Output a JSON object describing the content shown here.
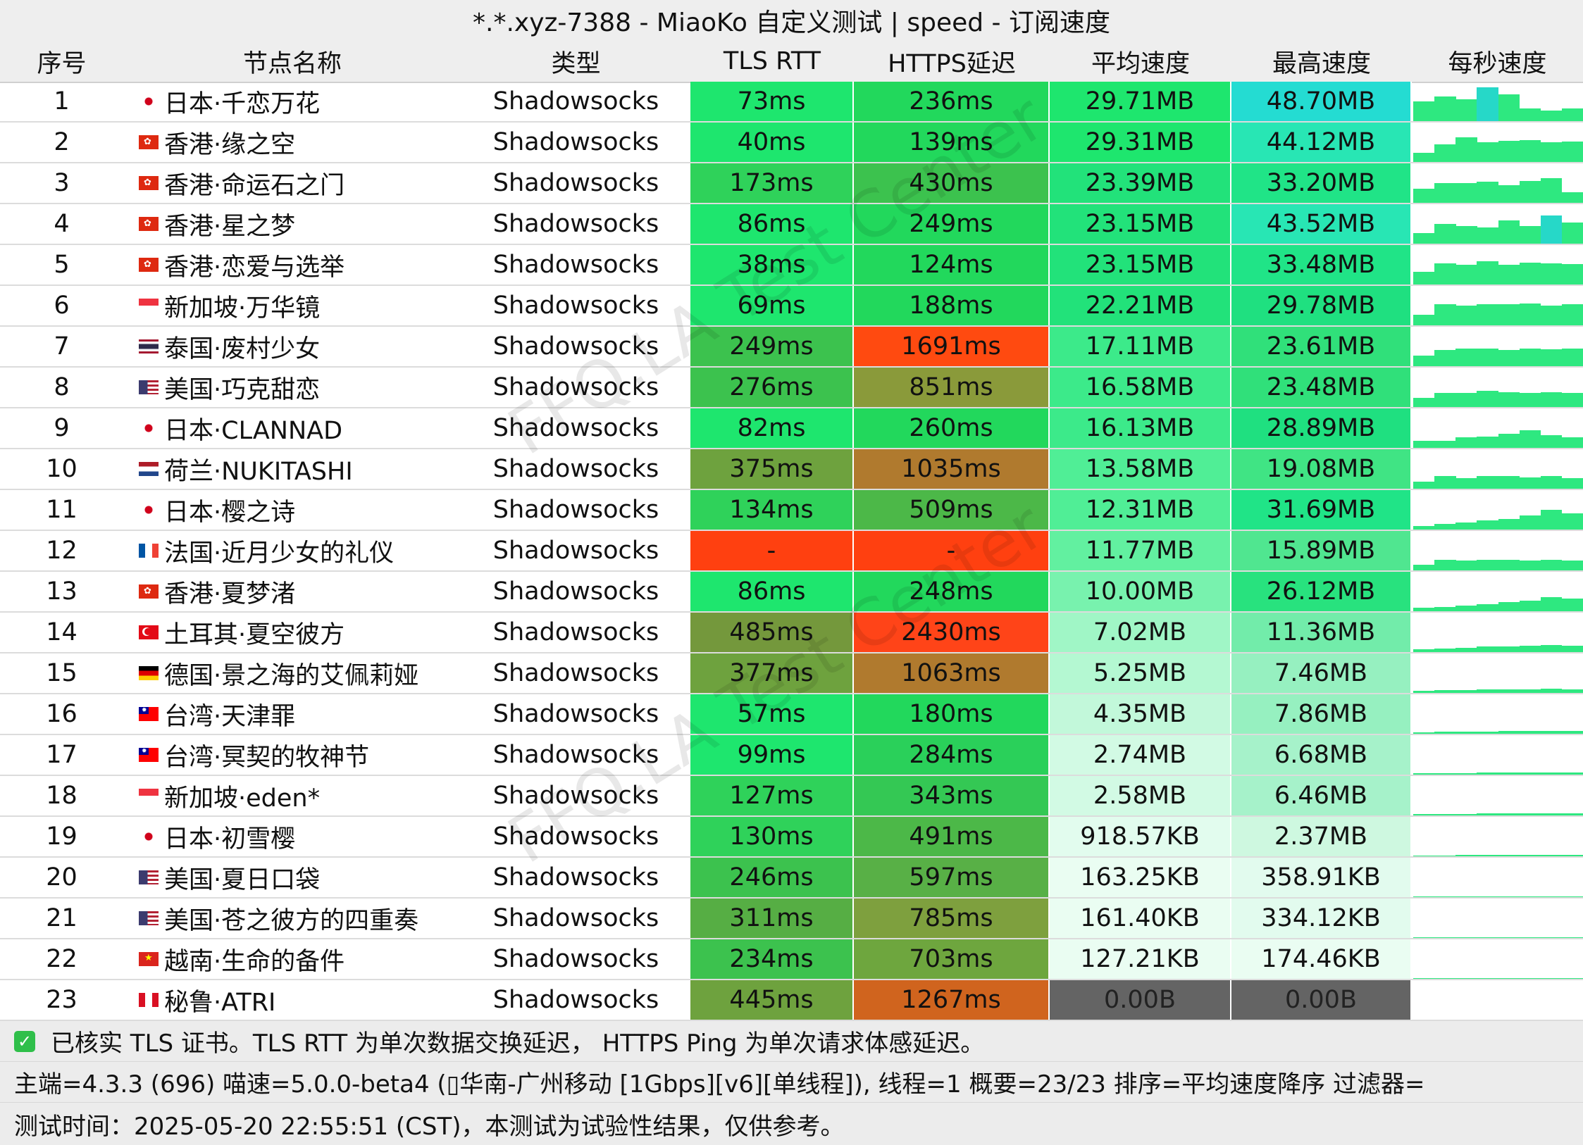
{
  "title": "*.*.xyz-7388 - MiaoKo 自定义测试 | speed - 订阅速度",
  "headers": [
    "序号",
    "节点名称",
    "类型",
    "TLS RTT",
    "HTTPS延迟",
    "平均速度",
    "最高速度",
    "每秒速度"
  ],
  "rows": [
    {
      "idx": "1",
      "flag": "jp-flag-icon",
      "name": "日本·千恋万花",
      "type": "Shadowsocks",
      "tls": "73ms",
      "tls_color": "#1ee66e",
      "https": "236ms",
      "https_color": "#22d85c",
      "avg": "29.71MB",
      "avg_color": "#1ee66e",
      "max": "48.70MB",
      "max_color": "#24dcd2",
      "spark": [
        0.55,
        0.7,
        0.62,
        0.95,
        0.75,
        0.35,
        0.3,
        0.35
      ]
    },
    {
      "idx": "2",
      "flag": "hk-flag-icon",
      "name": "香港·缘之空",
      "type": "Shadowsocks",
      "tls": "40ms",
      "tls_color": "#1ee66e",
      "https": "139ms",
      "https_color": "#22d85c",
      "avg": "29.31MB",
      "avg_color": "#1ee66e",
      "max": "44.12MB",
      "max_color": "#28e6b4",
      "spark": [
        0.25,
        0.5,
        0.7,
        0.55,
        0.6,
        0.62,
        0.55,
        0.58
      ]
    },
    {
      "idx": "3",
      "flag": "hk-flag-icon",
      "name": "香港·命运石之门",
      "type": "Shadowsocks",
      "tls": "173ms",
      "tls_color": "#2fd25a",
      "https": "430ms",
      "https_color": "#3cc24e",
      "avg": "23.39MB",
      "avg_color": "#22e27a",
      "max": "33.20MB",
      "max_color": "#20e487",
      "spark": [
        0.4,
        0.55,
        0.55,
        0.6,
        0.5,
        0.62,
        0.7,
        0.3
      ]
    },
    {
      "idx": "4",
      "flag": "hk-flag-icon",
      "name": "香港·星之梦",
      "type": "Shadowsocks",
      "tls": "86ms",
      "tls_color": "#1ee66e",
      "https": "249ms",
      "https_color": "#22d85c",
      "avg": "23.15MB",
      "avg_color": "#22e27a",
      "max": "43.52MB",
      "max_color": "#28e6b4",
      "spark": [
        0.3,
        0.55,
        0.5,
        0.45,
        0.65,
        0.5,
        0.8,
        0.6
      ]
    },
    {
      "idx": "5",
      "flag": "hk-flag-icon",
      "name": "香港·恋爱与选举",
      "type": "Shadowsocks",
      "tls": "38ms",
      "tls_color": "#1ee66e",
      "https": "124ms",
      "https_color": "#22d85c",
      "avg": "23.15MB",
      "avg_color": "#22e27a",
      "max": "33.48MB",
      "max_color": "#20e487",
      "spark": [
        0.35,
        0.6,
        0.55,
        0.65,
        0.55,
        0.62,
        0.6,
        0.58
      ]
    },
    {
      "idx": "6",
      "flag": "sg-flag-icon",
      "name": "新加坡·万华镜",
      "type": "Shadowsocks",
      "tls": "69ms",
      "tls_color": "#1ee66e",
      "https": "188ms",
      "https_color": "#22d85c",
      "avg": "22.21MB",
      "avg_color": "#22e27a",
      "max": "29.78MB",
      "max_color": "#1fe080",
      "spark": [
        0.3,
        0.6,
        0.55,
        0.6,
        0.6,
        0.62,
        0.55,
        0.6
      ]
    },
    {
      "idx": "7",
      "flag": "th-flag-icon",
      "name": "泰国·废村少女",
      "type": "Shadowsocks",
      "tls": "249ms",
      "tls_color": "#3cc24e",
      "https": "1691ms",
      "https_color": "#ff4a10",
      "avg": "17.11MB",
      "avg_color": "#3cea8a",
      "max": "23.61MB",
      "max_color": "#30e07a",
      "spark": [
        0.3,
        0.45,
        0.5,
        0.5,
        0.45,
        0.5,
        0.48,
        0.5
      ]
    },
    {
      "idx": "8",
      "flag": "us-flag-icon",
      "name": "美国·巧克甜恋",
      "type": "Shadowsocks",
      "tls": "276ms",
      "tls_color": "#3cc24e",
      "https": "851ms",
      "https_color": "#8a9a3a",
      "avg": "16.58MB",
      "avg_color": "#3cea8a",
      "max": "23.48MB",
      "max_color": "#30e07a",
      "spark": [
        0.25,
        0.4,
        0.4,
        0.45,
        0.42,
        0.4,
        0.42,
        0.4
      ]
    },
    {
      "idx": "9",
      "flag": "jp-flag-icon",
      "name": "日本·CLANNAD",
      "type": "Shadowsocks",
      "tls": "82ms",
      "tls_color": "#1ee66e",
      "https": "260ms",
      "https_color": "#22d85c",
      "avg": "16.13MB",
      "avg_color": "#3cea8a",
      "max": "28.89MB",
      "max_color": "#1fe080",
      "spark": [
        0.2,
        0.2,
        0.3,
        0.32,
        0.4,
        0.5,
        0.35,
        0.3
      ]
    },
    {
      "idx": "10",
      "flag": "nl-flag-icon",
      "name": "荷兰·NUKITASHI",
      "type": "Shadowsocks",
      "tls": "375ms",
      "tls_color": "#6ea23e",
      "https": "1035ms",
      "https_color": "#b07a2e",
      "avg": "13.58MB",
      "avg_color": "#50ee96",
      "max": "19.08MB",
      "max_color": "#40e484",
      "spark": [
        0.2,
        0.35,
        0.3,
        0.35,
        0.35,
        0.32,
        0.35,
        0.3
      ]
    },
    {
      "idx": "11",
      "flag": "jp-flag-icon",
      "name": "日本·樱之诗",
      "type": "Shadowsocks",
      "tls": "134ms",
      "tls_color": "#2fd25a",
      "https": "509ms",
      "https_color": "#4cb848",
      "avg": "12.31MB",
      "avg_color": "#50ee96",
      "max": "31.69MB",
      "max_color": "#20e487",
      "spark": [
        0.1,
        0.15,
        0.2,
        0.25,
        0.3,
        0.4,
        0.55,
        0.45
      ]
    },
    {
      "idx": "12",
      "flag": "fr-flag-icon",
      "name": "法国·近月少女的礼仪",
      "type": "Shadowsocks",
      "tls": "-",
      "tls_color": "#ff4010",
      "https": "-",
      "https_color": "#ff4010",
      "avg": "11.77MB",
      "avg_color": "#62f0a0",
      "max": "15.89MB",
      "max_color": "#50e690",
      "spark": [
        0.15,
        0.3,
        0.28,
        0.3,
        0.3,
        0.28,
        0.3,
        0.28
      ]
    },
    {
      "idx": "13",
      "flag": "hk-flag-icon",
      "name": "香港·夏梦渚",
      "type": "Shadowsocks",
      "tls": "86ms",
      "tls_color": "#1ee66e",
      "https": "248ms",
      "https_color": "#22d85c",
      "avg": "10.00MB",
      "avg_color": "#78f2ae",
      "max": "26.12MB",
      "max_color": "#28e27e",
      "spark": [
        0.1,
        0.12,
        0.15,
        0.2,
        0.25,
        0.3,
        0.4,
        0.35
      ]
    },
    {
      "idx": "14",
      "flag": "tr-flag-icon",
      "name": "土耳其·夏空彼方",
      "type": "Shadowsocks",
      "tls": "485ms",
      "tls_color": "#74983c",
      "https": "2430ms",
      "https_color": "#ff4418",
      "avg": "7.02MB",
      "avg_color": "#a0f6c6",
      "max": "11.36MB",
      "max_color": "#72ecaa",
      "spark": [
        0.08,
        0.1,
        0.12,
        0.15,
        0.15,
        0.18,
        0.2,
        0.18
      ]
    },
    {
      "idx": "15",
      "flag": "de-flag-icon",
      "name": "德国·景之海的艾佩莉娅",
      "type": "Shadowsocks",
      "tls": "377ms",
      "tls_color": "#6ea23e",
      "https": "1063ms",
      "https_color": "#b07a2e",
      "avg": "5.25MB",
      "avg_color": "#b4f8d2",
      "max": "7.46MB",
      "max_color": "#96f0c0",
      "spark": [
        0.05,
        0.08,
        0.08,
        0.1,
        0.1,
        0.1,
        0.12,
        0.1
      ]
    },
    {
      "idx": "16",
      "flag": "tw-flag-icon",
      "name": "台湾·天津罪",
      "type": "Shadowsocks",
      "tls": "57ms",
      "tls_color": "#1ee66e",
      "https": "180ms",
      "https_color": "#22d85c",
      "avg": "4.35MB",
      "avg_color": "#c2f8da",
      "max": "7.86MB",
      "max_color": "#96f0c0",
      "spark": [
        0.04,
        0.05,
        0.06,
        0.06,
        0.07,
        0.08,
        0.08,
        0.08
      ]
    },
    {
      "idx": "17",
      "flag": "tw-flag-icon",
      "name": "台湾·冥契的牧神节",
      "type": "Shadowsocks",
      "tls": "99ms",
      "tls_color": "#1ee66e",
      "https": "284ms",
      "https_color": "#2ad05a",
      "avg": "2.74MB",
      "avg_color": "#d2fae4",
      "max": "6.68MB",
      "max_color": "#a6f2ca",
      "spark": [
        0.03,
        0.04,
        0.04,
        0.05,
        0.05,
        0.05,
        0.06,
        0.05
      ]
    },
    {
      "idx": "18",
      "flag": "sg-flag-icon",
      "name": "新加坡·eden*",
      "type": "Shadowsocks",
      "tls": "127ms",
      "tls_color": "#2fd25a",
      "https": "343ms",
      "https_color": "#34c854",
      "avg": "2.58MB",
      "avg_color": "#d2fae4",
      "max": "6.46MB",
      "max_color": "#a6f2ca",
      "spark": [
        0.03,
        0.04,
        0.04,
        0.05,
        0.05,
        0.05,
        0.05,
        0.05
      ]
    },
    {
      "idx": "19",
      "flag": "jp-flag-icon",
      "name": "日本·初雪樱",
      "type": "Shadowsocks",
      "tls": "130ms",
      "tls_color": "#2fd25a",
      "https": "491ms",
      "https_color": "#4cb848",
      "avg": "918.57KB",
      "avg_color": "#e2fcee",
      "max": "2.37MB",
      "max_color": "#cef8e0",
      "spark": [
        0.02,
        0.02,
        0.03,
        0.03,
        0.03,
        0.03,
        0.03,
        0.03
      ]
    },
    {
      "idx": "20",
      "flag": "us-flag-icon",
      "name": "美国·夏日口袋",
      "type": "Shadowsocks",
      "tls": "246ms",
      "tls_color": "#3cc24e",
      "https": "597ms",
      "https_color": "#58b046",
      "avg": "163.25KB",
      "avg_color": "#eafdf2",
      "max": "358.91KB",
      "max_color": "#e2fbee",
      "spark": [
        0.01,
        0.01,
        0.01,
        0.01,
        0.01,
        0.01,
        0.01,
        0.01
      ]
    },
    {
      "idx": "21",
      "flag": "us-flag-icon",
      "name": "美国·苍之彼方的四重奏",
      "type": "Shadowsocks",
      "tls": "311ms",
      "tls_color": "#56ae44",
      "https": "785ms",
      "https_color": "#7ea03e",
      "avg": "161.40KB",
      "avg_color": "#eafdf2",
      "max": "334.12KB",
      "max_color": "#e2fbee",
      "spark": [
        0.01,
        0.01,
        0.01,
        0.01,
        0.01,
        0.01,
        0.01,
        0.01
      ]
    },
    {
      "idx": "22",
      "flag": "vn-flag-icon",
      "name": "越南·生命的备件",
      "type": "Shadowsocks",
      "tls": "234ms",
      "tls_color": "#3cc24e",
      "https": "703ms",
      "https_color": "#6ea63e",
      "avg": "127.21KB",
      "avg_color": "#eafdf2",
      "max": "174.46KB",
      "max_color": "#eafdf2",
      "spark": [
        0.01,
        0.01,
        0.01,
        0.01,
        0.01,
        0.01,
        0.01,
        0.01
      ]
    },
    {
      "idx": "23",
      "flag": "pe-flag-icon",
      "name": "秘鲁·ATRI",
      "type": "Shadowsocks",
      "tls": "445ms",
      "tls_color": "#6ea23e",
      "https": "1267ms",
      "https_color": "#d0641e",
      "avg": "0.00B",
      "avg_color": "#646464",
      "max": "0.00B",
      "max_color": "#646464",
      "spark": [
        0,
        0,
        0,
        0,
        0,
        0,
        0,
        0
      ]
    }
  ],
  "footer": {
    "line1": "已核实 TLS 证书。TLS RTT 为单次数据交换延迟， HTTPS Ping 为单次请求体感延迟。",
    "line2": "主端=4.3.3 (696) 喵速=5.0.0-beta4 (▯华南-广州移动 [1Gbps][v6][单线程]), 线程=1 概要=23/23 排序=平均速度降序 过滤器=",
    "line3": "测试时间：2025-05-20 22:55:51 (CST)，本测试为试验性结果，仅供参考。"
  },
  "watermark": "FFQ.LA Test Center",
  "colors": {
    "spark_bar": "#2ee880",
    "spark_peak": "#26d8c8",
    "header_bg": "#eeeeee"
  }
}
